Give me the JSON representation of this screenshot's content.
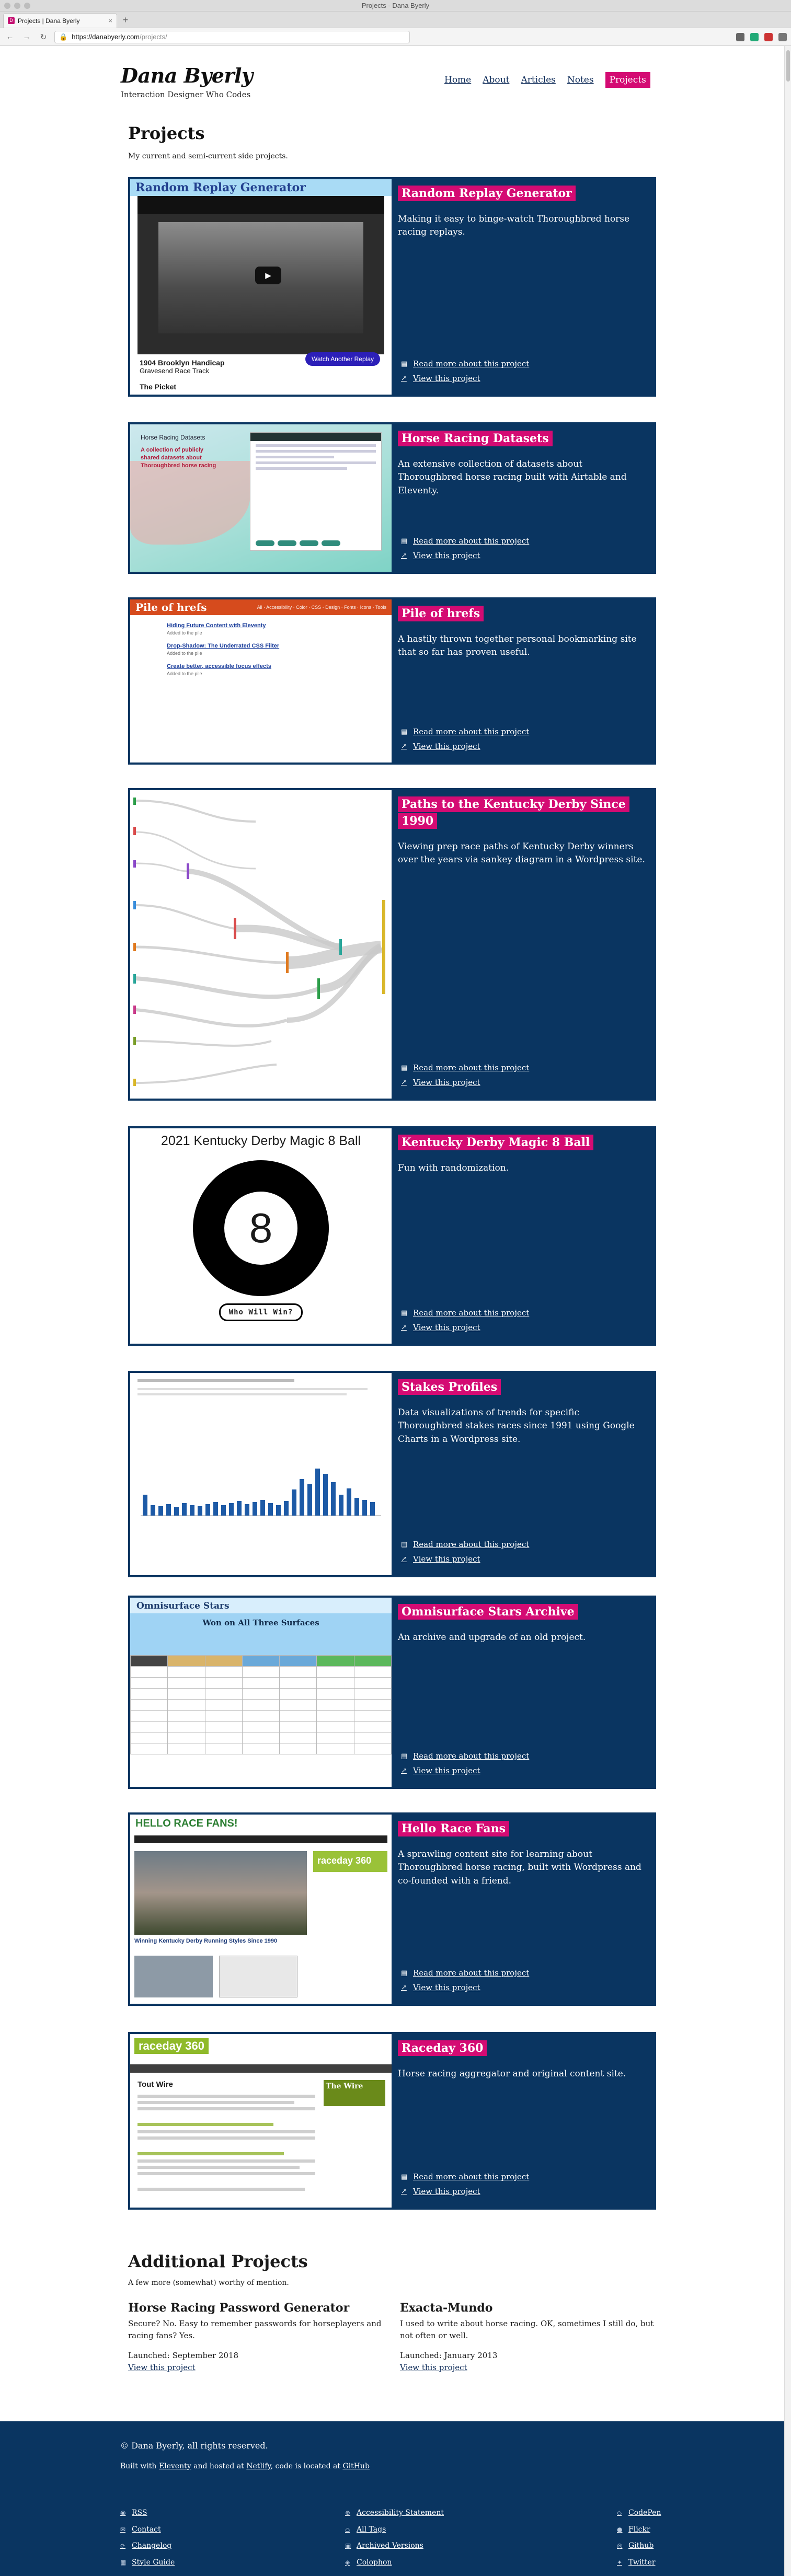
{
  "window": {
    "title": "Projects - Dana Byerly"
  },
  "browser": {
    "tab_title": "Projects | Dana Byerly",
    "tab_icon": "D",
    "new_tab_icon": "+",
    "tab_close_icon": "×",
    "url_host": "https://danabyerly.com",
    "url_path": "/projects/"
  },
  "site": {
    "name": "Dana Byerly",
    "tagline": "Interaction Designer Who Codes",
    "nav": [
      {
        "label": "Home",
        "active": false
      },
      {
        "label": "About",
        "active": false
      },
      {
        "label": "Articles",
        "active": false
      },
      {
        "label": "Notes",
        "active": false
      },
      {
        "label": "Projects",
        "active": true
      }
    ]
  },
  "projects_section": {
    "title": "Projects",
    "subtitle": "My current and semi-current side projects."
  },
  "project_links": {
    "about": "Read more about this project",
    "view": "View this project"
  },
  "projects": [
    {
      "title": "Random Replay Generator",
      "description": "Making it easy to binge-watch Thoroughbred horse racing replays."
    },
    {
      "title": "Horse Racing Datasets",
      "description": "An extensive collection of datasets about Thoroughbred horse racing built with Airtable and Eleventy."
    },
    {
      "title": "Pile of hrefs",
      "description": "A hastily thrown together personal bookmarking site that so far has proven useful."
    },
    {
      "title": "Paths to the Kentucky Derby Since 1990",
      "description": "Viewing prep race paths of Kentucky Derby winners over the years via sankey diagram in a Wordpress site."
    },
    {
      "title": "Kentucky Derby Magic 8 Ball",
      "description": "Fun with randomization."
    },
    {
      "title": "Stakes Profiles",
      "description": "Data visualizations of trends for specific Thoroughbred stakes races since 1991 using Google Charts in a Wordpress site."
    },
    {
      "title": "Omnisurface Stars Archive",
      "description": "An archive and upgrade of an old project."
    },
    {
      "title": "Hello Race Fans",
      "description": "A sprawling content site for learning about Thoroughbred horse racing, built with Wordpress and co-founded with a friend."
    },
    {
      "title": "Raceday 360",
      "description": "Horse racing aggregator and original content site."
    }
  ],
  "thumbs": {
    "replay": {
      "banner": "Random Replay Generator",
      "race": "1904 Brooklyn Handicap",
      "track": "Gravesend Race Track",
      "winner": "The Picket",
      "button": "Watch Another Replay"
    },
    "datasets": {
      "header": "Horse Racing Datasets",
      "headline": "A collection of publicly shared datasets about Thoroughbred horse racing"
    },
    "hrefs": {
      "brand": "Pile of hrefs",
      "items": [
        "Hiding Future Content with Eleventy",
        "Drop-Shadow: The Underrated CSS Filter",
        "Create better, accessible focus effects"
      ]
    },
    "magic8": {
      "heading": "2021 Kentucky Derby Magic 8 Ball",
      "number": "8",
      "button": "Who Will Win?"
    },
    "omni": {
      "brand": "Omnisurface Stars",
      "band": "Won on All Three Surfaces"
    },
    "hello": {
      "brand": "HELLO RACE FANS!",
      "side": "raceday 360",
      "caption": "Winning Kentucky Derby Running Styles Since 1990"
    },
    "raceday": {
      "logo": "raceday 360",
      "heading": "Tout Wire",
      "ad": "The Wire"
    }
  },
  "additional": {
    "title": "Additional Projects",
    "subtitle": "A few more (somewhat) worthy of mention.",
    "items": [
      {
        "title": "Horse Racing Password Generator",
        "description": "Secure? No. Easy to remember passwords for horseplayers and racing fans? Yes.",
        "launched": "Launched: September 2018",
        "link": "View this project"
      },
      {
        "title": "Exacta-Mundo",
        "description": "I used to write about horse racing. OK, sometimes I still do, but not often or well.",
        "launched": "Launched: January 2013",
        "link": "View this project"
      }
    ]
  },
  "footer": {
    "copyright": "© Dana Byerly, all rights reserved.",
    "built_prefix": "Built with",
    "eleventy": "Eleventy",
    "hosted": "and hosted at",
    "netlify": "Netlify",
    "code": ", code is located at",
    "github": "GitHub",
    "col1": [
      "RSS",
      "Contact",
      "Changelog",
      "Style Guide"
    ],
    "col2": [
      "Accessibility Statement",
      "All Tags",
      "Archived Versions",
      "Colophon"
    ],
    "col3": [
      "CodePen",
      "Flickr",
      "Github",
      "Twitter"
    ]
  }
}
